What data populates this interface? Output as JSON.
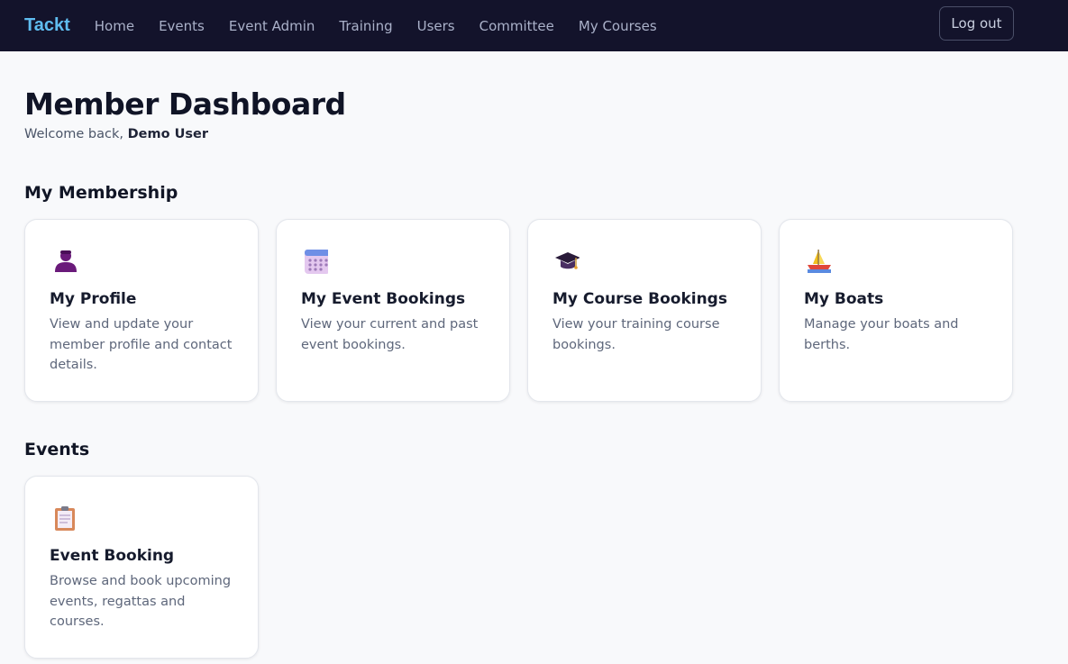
{
  "nav": {
    "brand": "Tackt",
    "links": [
      "Home",
      "Events",
      "Event Admin",
      "Training",
      "Users",
      "Committee",
      "My Courses"
    ],
    "logout_label": "Log out"
  },
  "page": {
    "title": "Member Dashboard",
    "welcome_prefix": "Welcome back, ",
    "user_name": "Demo User"
  },
  "sections": [
    {
      "title": "My Membership",
      "cards": [
        {
          "icon": "person-icon",
          "title": "My Profile",
          "description": "View and update your member profile and contact details."
        },
        {
          "icon": "calendar-icon",
          "title": "My Event Bookings",
          "description": "View your current and past event bookings."
        },
        {
          "icon": "graduation-cap-icon",
          "title": "My Course Bookings",
          "description": "View your training course bookings."
        },
        {
          "icon": "sailboat-icon",
          "title": "My Boats",
          "description": "Manage your boats and berths."
        }
      ]
    },
    {
      "title": "Events",
      "cards": [
        {
          "icon": "clipboard-icon",
          "title": "Event Booking",
          "description": "Browse and book upcoming events, regattas and courses."
        }
      ]
    }
  ],
  "colors": {
    "navbar_bg": "#13132b",
    "brand": "#5fbdf0",
    "page_bg": "#f8f9fb"
  }
}
